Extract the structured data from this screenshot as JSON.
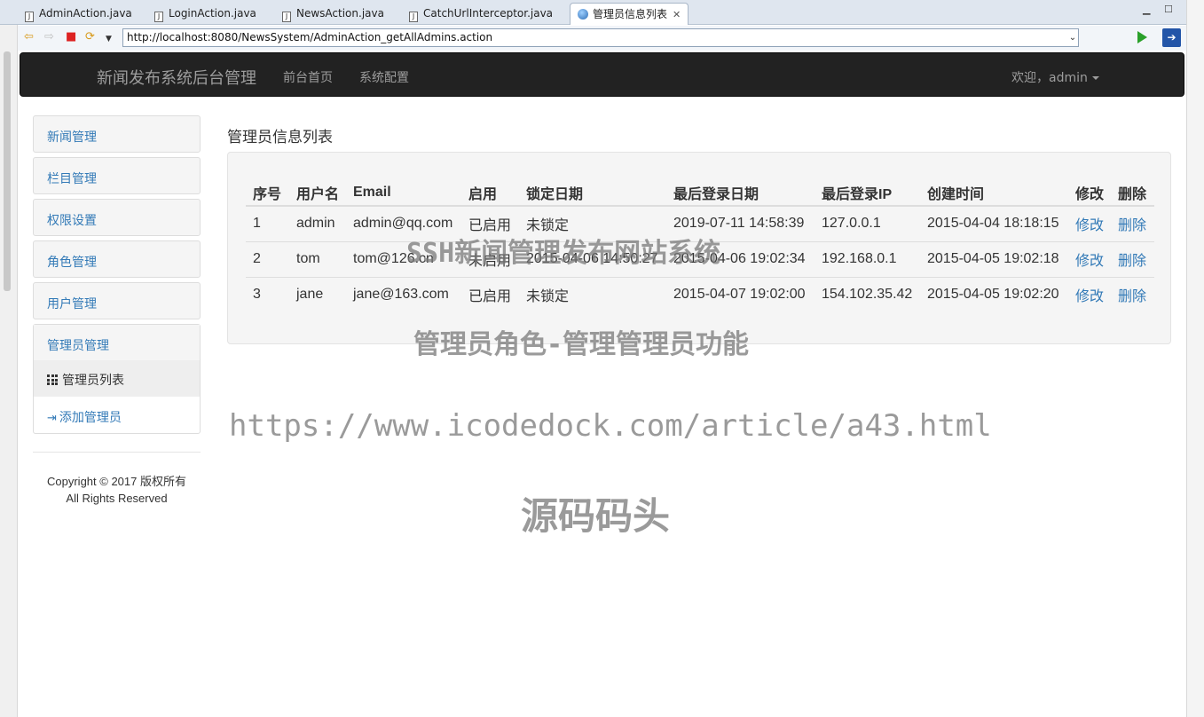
{
  "eclipse": {
    "tabs": [
      {
        "label": "AdminAction.java"
      },
      {
        "label": "LoginAction.java"
      },
      {
        "label": "NewsAction.java"
      },
      {
        "label": "CatchUrlInterceptor.java"
      },
      {
        "label": "管理员信息列表"
      }
    ],
    "url": "http://localhost:8080/NewsSystem/AdminAction_getAllAdmins.action"
  },
  "navbar": {
    "brand": "新闻发布系统后台管理",
    "links": [
      "前台首页",
      "系统配置"
    ],
    "welcome": "欢迎，admin"
  },
  "sidebar": {
    "items": [
      "新闻管理",
      "栏目管理",
      "权限设置",
      "角色管理",
      "用户管理"
    ],
    "group": {
      "title": "管理员管理",
      "sub": [
        "管理员列表",
        "添加管理员"
      ]
    },
    "copyright_line1": "Copyright © 2017 版权所有",
    "copyright_line2": "All Rights Reserved"
  },
  "main": {
    "title": "管理员信息列表",
    "columns": [
      "序号",
      "用户名",
      "Email",
      "启用",
      "锁定日期",
      "最后登录日期",
      "最后登录IP",
      "创建时间",
      "修改",
      "删除"
    ],
    "rows": [
      [
        "1",
        "admin",
        "admin@qq.com",
        "已启用",
        "未锁定",
        "2019-07-11 14:58:39",
        "127.0.0.1",
        "2015-04-04 18:18:15",
        "修改",
        "删除"
      ],
      [
        "2",
        "tom",
        "tom@126.cn",
        "未启用",
        "2015-04-06 14:50:27",
        "2015-04-06 19:02:34",
        "192.168.0.1",
        "2015-04-05 19:02:18",
        "修改",
        "删除"
      ],
      [
        "3",
        "jane",
        "jane@163.com",
        "已启用",
        "未锁定",
        "2015-04-07 19:02:00",
        "154.102.35.42",
        "2015-04-05 19:02:20",
        "修改",
        "删除"
      ]
    ]
  },
  "watermarks": {
    "line1": "SSH新闻管理发布网站系统",
    "line2": "管理员角色-管理管理员功能",
    "line3": "https://www.icodedock.com/article/a43.html",
    "line4": "源码码头"
  }
}
